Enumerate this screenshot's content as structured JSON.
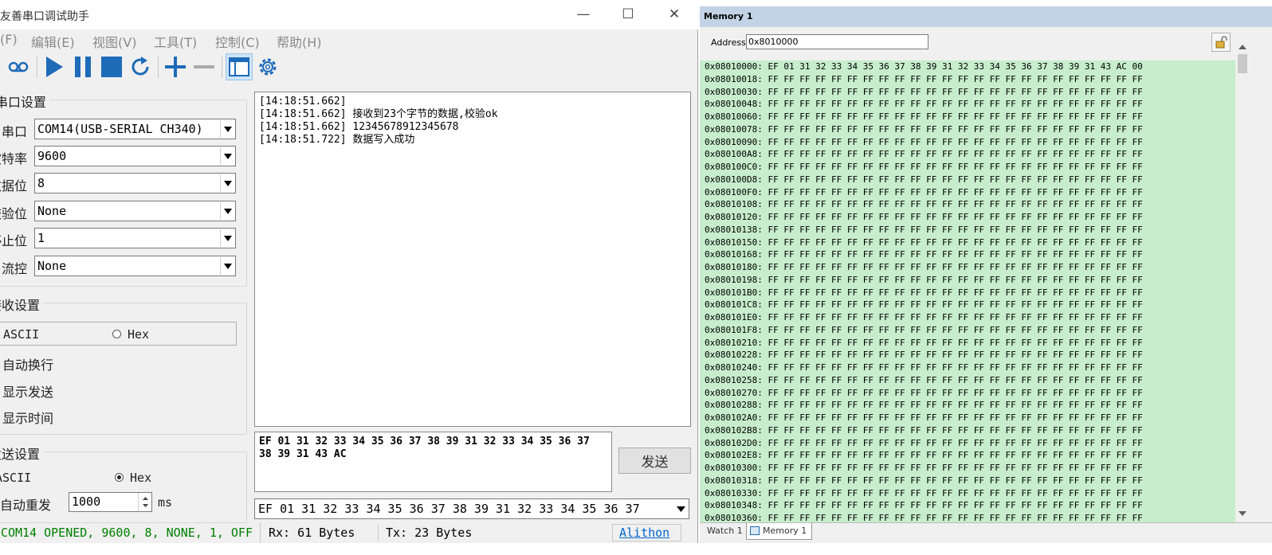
{
  "serial": {
    "title": "友善串口调试助手",
    "menu": [
      "(F)",
      "编辑(E)",
      "视图(V)",
      "工具(T)",
      "控制(C)",
      "帮助(H)"
    ],
    "port_settings": {
      "title": "串口设置",
      "fields": [
        {
          "label": "串口",
          "value": "COM14(USB-SERIAL CH340)"
        },
        {
          "label": "波特率",
          "value": "9600"
        },
        {
          "label": "数据位",
          "value": "8"
        },
        {
          "label": "校验位",
          "value": "None"
        },
        {
          "label": "停止位",
          "value": "1"
        },
        {
          "label": "流控",
          "value": "None"
        }
      ]
    },
    "rx_settings": {
      "title": "接收设置",
      "ascii_label": "ASCII",
      "hex_label": "Hex",
      "auto_newline": "自动换行",
      "show_send": "显示发送",
      "show_time": "显示时间"
    },
    "tx_settings": {
      "title": "发送设置",
      "ascii_label": "ASCII",
      "hex_label": "Hex",
      "auto_resend": "自动重发",
      "interval": "1000",
      "unit": "ms"
    },
    "rx_log": [
      "[14:18:51.662]",
      "[14:18:51.662] 接收到23个字节的数据,校验ok",
      "[14:18:51.662] 12345678912345678",
      "[14:18:51.722] 数据写入成功"
    ],
    "tx_text": [
      "EF 01 31 32 33 34 35 36 37 38 39 31 32 33 34 35 36 37",
      "38 39 31 43 AC"
    ],
    "send_label": "发送",
    "history_value": "EF 01 31 32 33 34 35 36 37 38 39 31 32 33 34 35 36 37",
    "status": {
      "port": "COM14 OPENED, 9600, 8, NONE, 1, OFF",
      "rx": "Rx: 61 Bytes",
      "tx": "Tx: 23 Bytes",
      "link": "Alithon"
    }
  },
  "memory": {
    "title": "Memory 1",
    "address_label": "Address:",
    "address_value": "0x8010000",
    "first_row_bytes": "EF 01 31 32 33 34 35 36 37 38 39 31 32 33 34 35 36 37 38 39 31 43 AC 00",
    "fill_bytes": "FF FF FF FF FF FF FF FF FF FF FF FF FF FF FF FF FF FF FF FF FF FF FF FF",
    "addresses": [
      "0x08010000",
      "0x08010018",
      "0x08010030",
      "0x08010048",
      "0x08010060",
      "0x08010078",
      "0x08010090",
      "0x080100A8",
      "0x080100C0",
      "0x080100D8",
      "0x080100F0",
      "0x08010108",
      "0x08010120",
      "0x08010138",
      "0x08010150",
      "0x08010168",
      "0x08010180",
      "0x08010198",
      "0x080101B0",
      "0x080101C8",
      "0x080101E0",
      "0x080101F8",
      "0x08010210",
      "0x08010228",
      "0x08010240",
      "0x08010258",
      "0x08010270",
      "0x08010288",
      "0x080102A0",
      "0x080102B8",
      "0x080102D0",
      "0x080102E8",
      "0x08010300",
      "0x08010318",
      "0x08010330",
      "0x08010348",
      "0x08010360"
    ],
    "tabs": [
      "Watch 1",
      "Memory 1"
    ]
  },
  "colors": {
    "status_green": "#008000",
    "link_blue": "#0066cc",
    "play_blue": "#1e6bb8",
    "memory_bg": "#c7edcc",
    "memory_title": "#c2d3e5"
  }
}
